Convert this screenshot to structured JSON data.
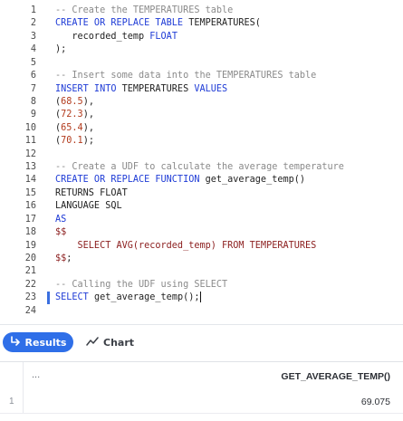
{
  "editor": {
    "lines": [
      {
        "n": "1",
        "tokens": [
          {
            "t": "-- Create the TEMPERATURES table",
            "c": "cm"
          }
        ]
      },
      {
        "n": "2",
        "tokens": [
          {
            "t": "CREATE OR REPLACE TABLE",
            "c": "kw"
          },
          {
            "t": " TEMPERATURES(",
            "c": "fn"
          }
        ]
      },
      {
        "n": "3",
        "tokens": [
          {
            "t": "   recorded_temp ",
            "c": "fn"
          },
          {
            "t": "FLOAT",
            "c": "kw"
          }
        ]
      },
      {
        "n": "4",
        "tokens": [
          {
            "t": ");",
            "c": "op"
          }
        ]
      },
      {
        "n": "5",
        "tokens": []
      },
      {
        "n": "6",
        "tokens": [
          {
            "t": "-- Insert some data into the TEMPERATURES table",
            "c": "cm"
          }
        ]
      },
      {
        "n": "7",
        "tokens": [
          {
            "t": "INSERT INTO",
            "c": "kw"
          },
          {
            "t": " TEMPERATURES ",
            "c": "fn"
          },
          {
            "t": "VALUES",
            "c": "kw"
          }
        ]
      },
      {
        "n": "8",
        "tokens": [
          {
            "t": "(",
            "c": "op"
          },
          {
            "t": "68.5",
            "c": "num"
          },
          {
            "t": "),",
            "c": "op"
          }
        ]
      },
      {
        "n": "9",
        "tokens": [
          {
            "t": "(",
            "c": "op"
          },
          {
            "t": "72.3",
            "c": "num"
          },
          {
            "t": "),",
            "c": "op"
          }
        ]
      },
      {
        "n": "10",
        "tokens": [
          {
            "t": "(",
            "c": "op"
          },
          {
            "t": "65.4",
            "c": "num"
          },
          {
            "t": "),",
            "c": "op"
          }
        ]
      },
      {
        "n": "11",
        "tokens": [
          {
            "t": "(",
            "c": "op"
          },
          {
            "t": "70.1",
            "c": "num"
          },
          {
            "t": ");",
            "c": "op"
          }
        ]
      },
      {
        "n": "12",
        "tokens": []
      },
      {
        "n": "13",
        "tokens": [
          {
            "t": "-- Create a UDF to calculate the average temperature",
            "c": "cm"
          }
        ]
      },
      {
        "n": "14",
        "tokens": [
          {
            "t": "CREATE OR REPLACE FUNCTION",
            "c": "kw"
          },
          {
            "t": " get_average_temp()",
            "c": "fn"
          }
        ]
      },
      {
        "n": "15",
        "tokens": [
          {
            "t": "RETURNS FLOAT",
            "c": "fn"
          }
        ]
      },
      {
        "n": "16",
        "tokens": [
          {
            "t": "LANGUAGE SQL",
            "c": "fn"
          }
        ]
      },
      {
        "n": "17",
        "tokens": [
          {
            "t": "AS",
            "c": "kw"
          }
        ]
      },
      {
        "n": "18",
        "tokens": [
          {
            "t": "$$",
            "c": "str"
          }
        ]
      },
      {
        "n": "19",
        "tokens": [
          {
            "t": "    SELECT AVG(recorded_temp) FROM TEMPERATURES",
            "c": "str"
          }
        ]
      },
      {
        "n": "20",
        "tokens": [
          {
            "t": "$$",
            "c": "str"
          },
          {
            "t": ";",
            "c": "op"
          }
        ]
      },
      {
        "n": "21",
        "tokens": []
      },
      {
        "n": "22",
        "tokens": [
          {
            "t": "-- Calling the UDF using SELECT",
            "c": "cm"
          }
        ]
      },
      {
        "n": "23",
        "tokens": [
          {
            "t": "SELECT",
            "c": "kw"
          },
          {
            "t": " get_average_temp();",
            "c": "fn"
          }
        ],
        "active": true
      },
      {
        "n": "24",
        "tokens": []
      }
    ]
  },
  "tabs": {
    "results_label": "Results",
    "chart_label": "Chart",
    "results_icon": "return-arrow-icon",
    "chart_icon": "trend-line-icon",
    "accent_color": "#2f6fe8"
  },
  "grid": {
    "menu_label": "...",
    "column_header": "GET_AVERAGE_TEMP()",
    "rows": [
      {
        "index": "1",
        "value": "69.075"
      }
    ]
  }
}
